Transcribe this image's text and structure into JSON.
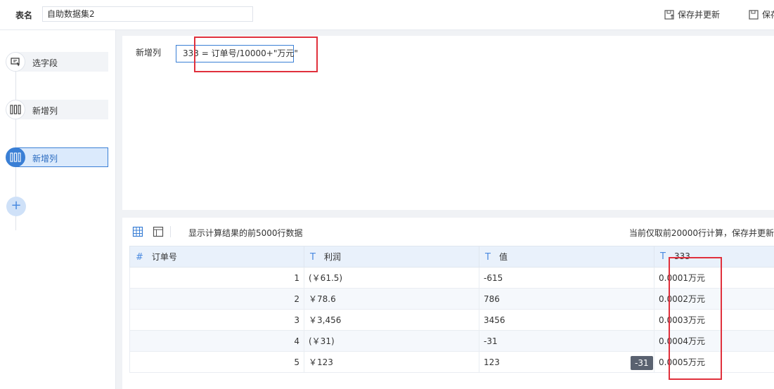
{
  "header": {
    "table_name_label": "表名",
    "table_name_value": "自助数据集2",
    "save_update_label": "保存并更新",
    "save_label": "保存"
  },
  "sidebar": {
    "steps": [
      {
        "label": "选字段",
        "icon": "select-field-icon"
      },
      {
        "label": "新增列",
        "icon": "add-column-icon"
      },
      {
        "label": "新增列",
        "icon": "add-column-icon",
        "active": true
      }
    ],
    "add_label": "+"
  },
  "editor": {
    "new_column_label": "新增列",
    "formula_value": "333 = 订单号/10000+\"万元\""
  },
  "preview": {
    "info_text": "显示计算结果的前5000行数据",
    "info_right": "当前仅取前20000行计算，保存并更新",
    "columns": [
      {
        "type_icon": "#",
        "name": "订单号"
      },
      {
        "type_icon": "T",
        "name": "利润"
      },
      {
        "type_icon": "T",
        "name": "值"
      },
      {
        "type_icon": "T",
        "name": "333"
      }
    ],
    "rows": [
      {
        "order_no": "1",
        "profit": "(￥61.5)",
        "value": "-615",
        "c333": "0.0001万元"
      },
      {
        "order_no": "2",
        "profit": "￥78.6",
        "value": "786",
        "c333": "0.0002万元"
      },
      {
        "order_no": "3",
        "profit": "￥3,456",
        "value": "3456",
        "c333": "0.0003万元"
      },
      {
        "order_no": "4",
        "profit": "(￥31)",
        "value": "-31",
        "c333": "0.0004万元"
      },
      {
        "order_no": "5",
        "profit": "￥123",
        "value": "123",
        "c333": "0.0005万元"
      }
    ],
    "tooltip_text": "-31"
  },
  "colors": {
    "accent": "#3a7fd5",
    "highlight_red": "#e0303c",
    "header_bg": "#e9f1fb"
  }
}
